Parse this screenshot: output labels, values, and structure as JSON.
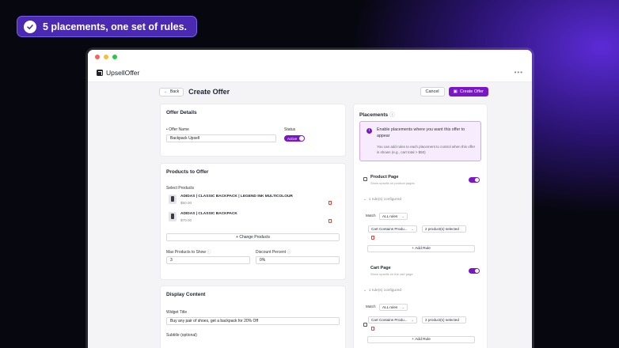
{
  "banner": {
    "text": "5 placements, one set of rules."
  },
  "app": {
    "name": "UpsellOffer"
  },
  "header": {
    "back_label": "Back",
    "title": "Create Offer",
    "cancel_label": "Cancel",
    "create_label": "Create Offer"
  },
  "offer_details": {
    "title": "Offer Details",
    "name_label": "Offer Name",
    "name_value": "Backpack Upsell",
    "status_label": "Status",
    "status_value": "Active"
  },
  "products": {
    "title": "Products to Offer",
    "select_label": "Select Products",
    "items": [
      {
        "name": "ADIDAS | CLASSIC BACKPACK | LEGEND INK MULTICOLOUR",
        "price": "$50.00"
      },
      {
        "name": "ADIDAS | CLASSIC BACKPACK",
        "price": "$70.00"
      }
    ],
    "change_label": "Change Products",
    "max_label": "Max Products to Show",
    "max_value": "3",
    "discount_label": "Discount Percent",
    "discount_value": "0%"
  },
  "display": {
    "title": "Display Content",
    "widget_label": "Widget Title",
    "widget_value": "Buy any pair of shoes, get a backpack for 20% Off",
    "subtitle_label": "Subtitle (optional)"
  },
  "placements": {
    "title": "Placements",
    "info_title": "Enable placements where you want this offer to appear",
    "info_body": "You can add rules to each placement to control when this offer is shown (e.g., cart total > $50)",
    "items": [
      {
        "title": "Product Page",
        "subtitle": "Show upsells on product pages",
        "configured": "1 rule(s) configured",
        "match_label": "Match",
        "match_value": "ALL rules",
        "condition": "Cart Contains Produ...",
        "condition_value": "2 product(s) selected",
        "add_rule": "Add Rule"
      },
      {
        "title": "Cart Page",
        "subtitle": "Show upsells on the cart page",
        "configured": "1 rule(s) configured",
        "match_label": "Match",
        "match_value": "ALL rules",
        "condition": "Cart Contains Produ...",
        "condition_value": "2 product(s) selected",
        "add_rule": "Add Rule"
      }
    ]
  },
  "colors": {
    "accent": "#7a16c8",
    "banner": "#4a2ab0"
  }
}
